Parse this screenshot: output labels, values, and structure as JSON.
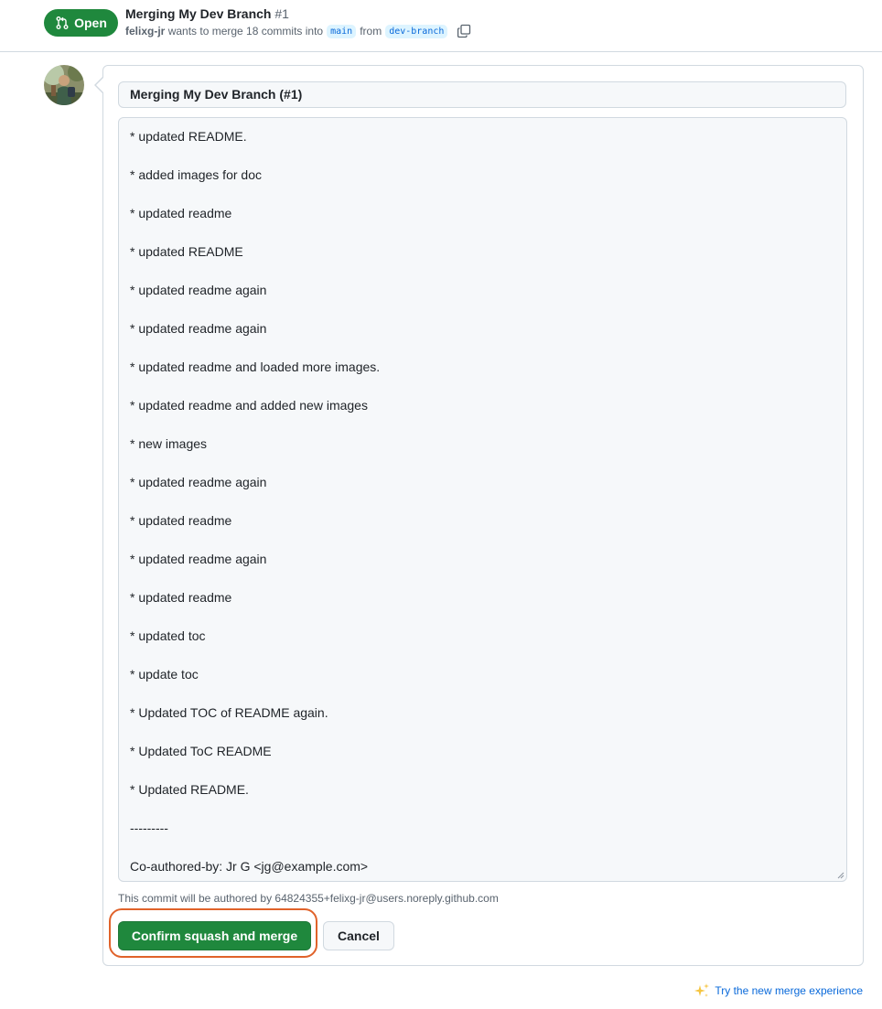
{
  "header": {
    "state_label": "Open",
    "title": "Merging My Dev Branch",
    "number": "#1",
    "author": "felixg-jr",
    "merge_text": "wants to merge 18 commits into",
    "base_branch": "main",
    "from_text": "from",
    "head_branch": "dev-branch",
    "colors": {
      "open": "#1f883d",
      "link": "#0969da"
    }
  },
  "merge_form": {
    "commit_title": "Merging My Dev Branch (#1)",
    "commit_message_lines": [
      "* updated README.",
      "* added images for doc",
      "* updated readme",
      "* updated README",
      "* updated readme again",
      "* updated readme again",
      "* updated readme and loaded more images.",
      "* updated readme and added new images",
      "* new images",
      "* updated readme again",
      "* updated readme",
      "* updated readme again",
      "* updated readme",
      "* updated toc",
      "* update toc",
      "* Updated TOC of README again.",
      "* Updated ToC README",
      "* Updated README.",
      "---------",
      "Co-authored-by: Jr G <jg@example.com>"
    ],
    "author_note": "This commit will be authored by 64824355+felixg-jr@users.noreply.github.com",
    "confirm_label": "Confirm squash and merge",
    "cancel_label": "Cancel",
    "highlight_color": "#e0622a"
  },
  "footer": {
    "try_new_label": "Try the new merge experience",
    "icon": "sparkles-icon"
  }
}
